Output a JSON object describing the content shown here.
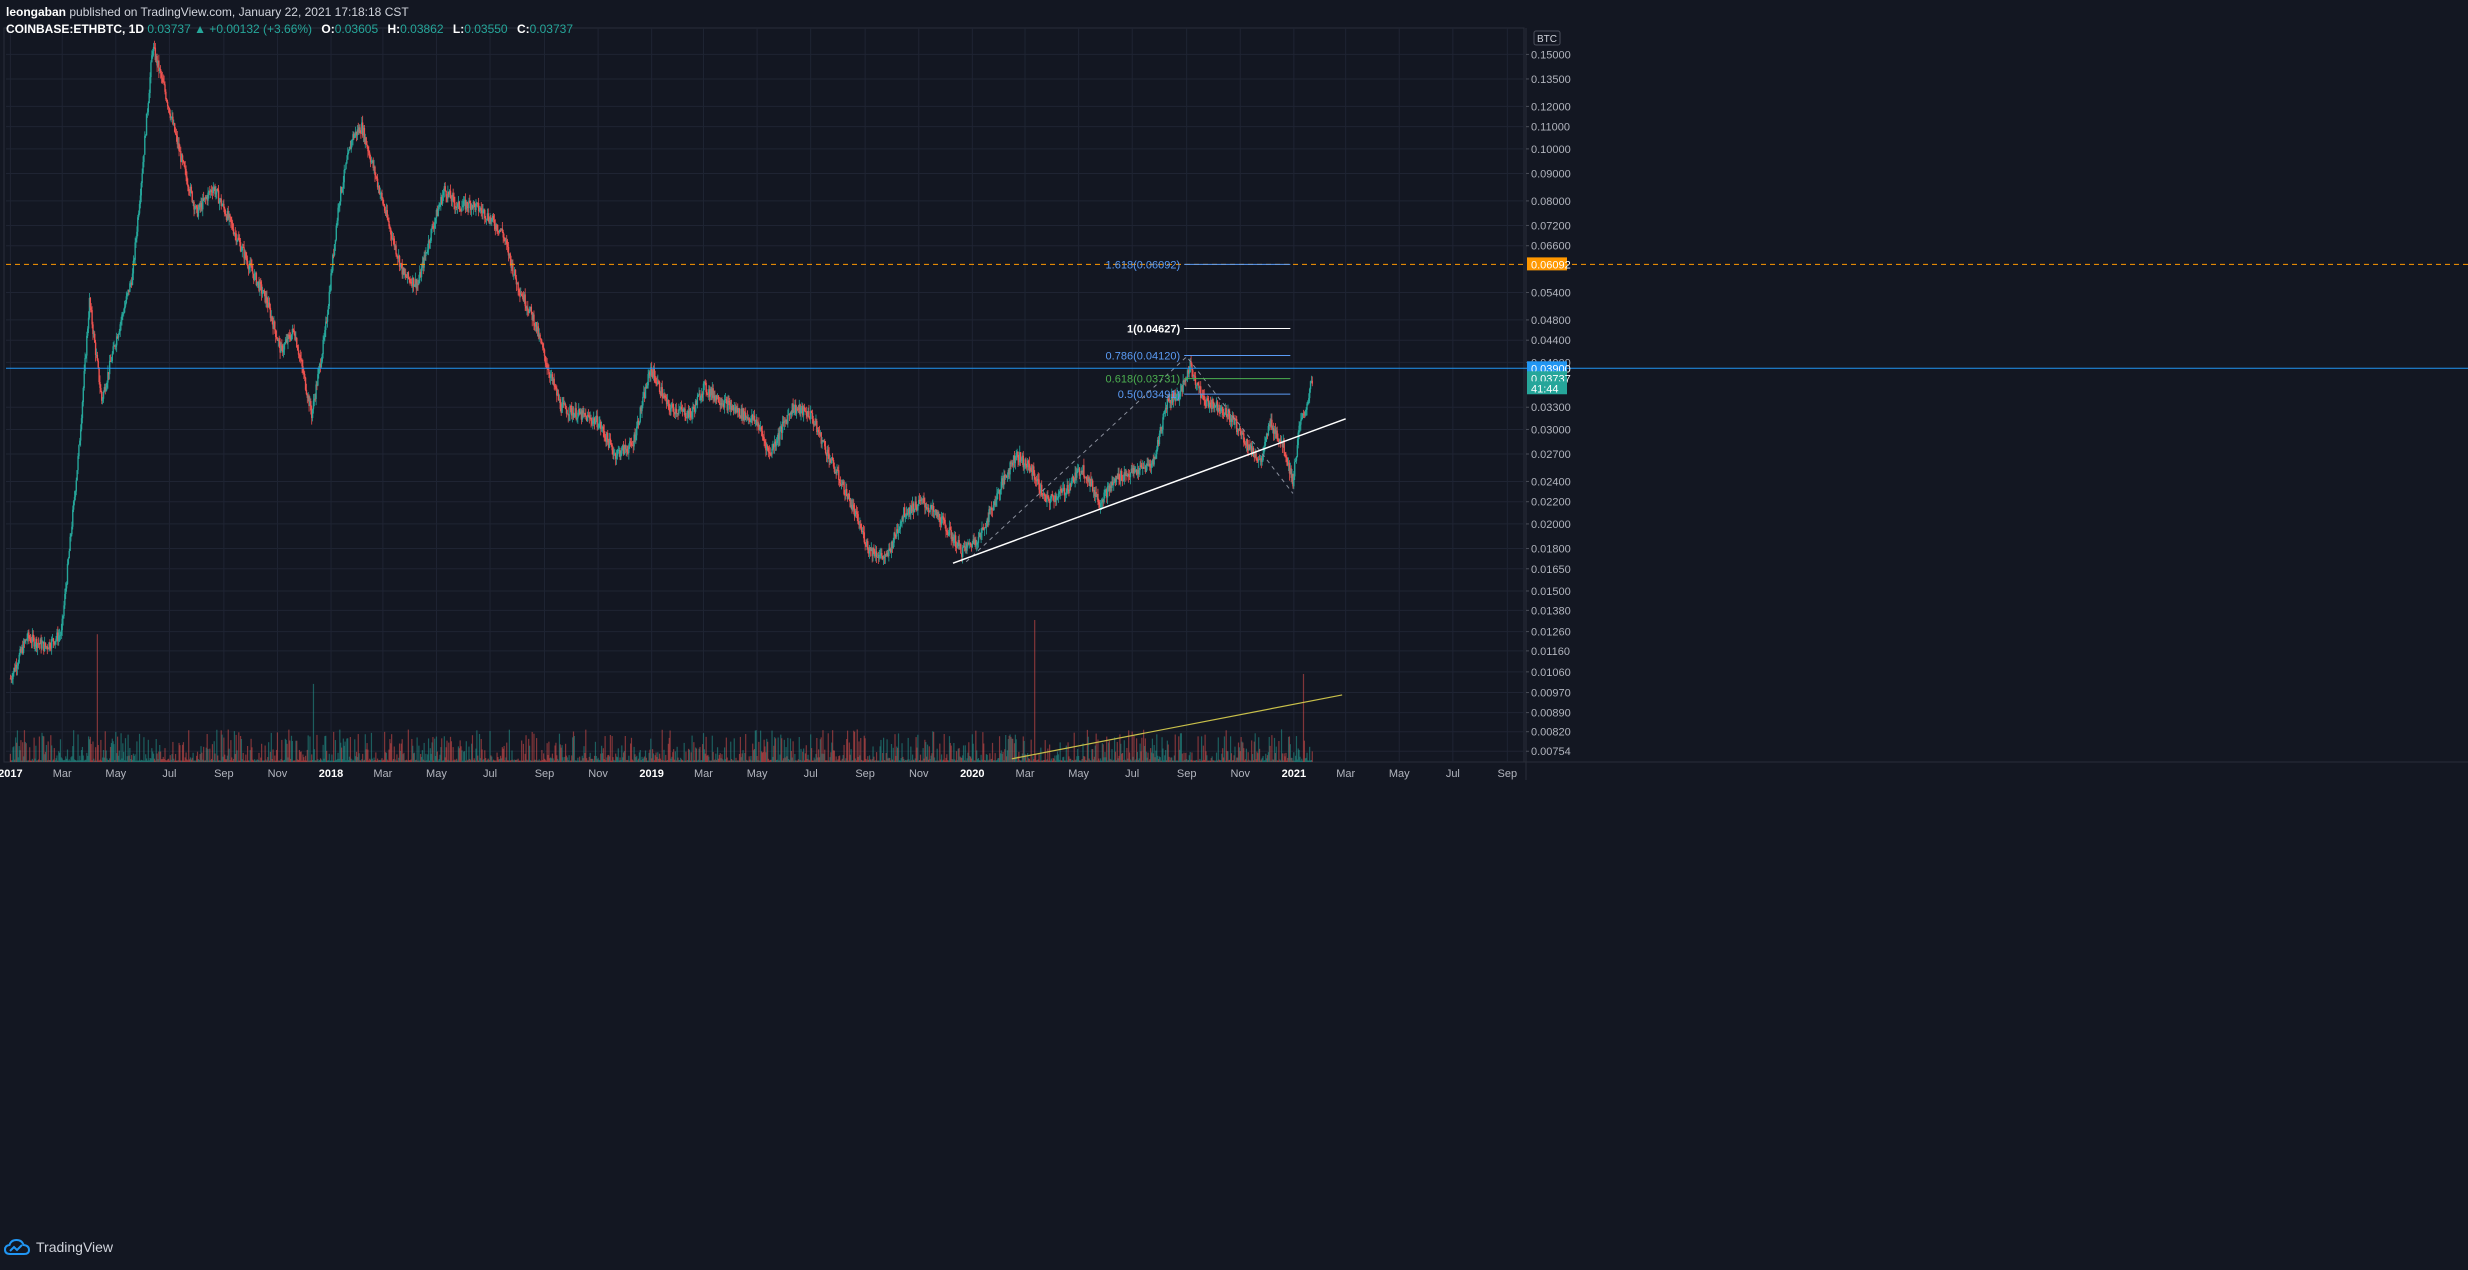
{
  "header": {
    "publisher": "leongaban",
    "published_text": "published on TradingView.com, January 22, 2021 17:18:18 CST",
    "symbol": "COINBASE:ETHBTC, 1D",
    "last": "0.03737",
    "change": "▲ +0.00132 (+3.66%)",
    "open_label": "O:",
    "open": "0.03605",
    "high_label": "H:",
    "high": "0.03862",
    "low_label": "L:",
    "low": "0.03550",
    "close_label": "C:",
    "close": "0.03737"
  },
  "footer": {
    "brand": "TradingView"
  },
  "colors": {
    "background": "#131722",
    "up": "#26a69a",
    "down": "#ef5350",
    "grid": "#1f2433",
    "blue_line": "#2196f3",
    "orange_line": "#ff9800",
    "trendline": "#ffffff",
    "volume_trend": "#c9c04a",
    "fib_blue": "#5b9cf6",
    "fib_green": "#4caf50"
  },
  "chart_data": {
    "type": "candlestick",
    "currency_label": "BTC",
    "y_scale": "log",
    "ylim": [
      0.0072,
      0.168
    ],
    "x_ticks": [
      "2017",
      "Mar",
      "May",
      "Jul",
      "Sep",
      "Nov",
      "2018",
      "Mar",
      "May",
      "Jul",
      "Sep",
      "Nov",
      "2019",
      "Mar",
      "May",
      "Jul",
      "Sep",
      "Nov",
      "2020",
      "Mar",
      "May",
      "Jul",
      "Sep",
      "Nov",
      "2021",
      "Mar",
      "May",
      "Jul",
      "Sep"
    ],
    "x_tick_dates": [
      "2017-01-01",
      "2017-03-01",
      "2017-05-01",
      "2017-07-01",
      "2017-09-01",
      "2017-11-01",
      "2018-01-01",
      "2018-03-01",
      "2018-05-01",
      "2018-07-01",
      "2018-09-01",
      "2018-11-01",
      "2019-01-01",
      "2019-03-01",
      "2019-05-01",
      "2019-07-01",
      "2019-09-01",
      "2019-11-01",
      "2020-01-01",
      "2020-03-01",
      "2020-05-01",
      "2020-07-01",
      "2020-09-01",
      "2020-11-01",
      "2021-01-01",
      "2021-03-01",
      "2021-05-01",
      "2021-07-01",
      "2021-09-01"
    ],
    "y_ticks": [
      "0.15000",
      "0.13500",
      "0.12000",
      "0.11000",
      "0.10000",
      "0.09000",
      "0.08000",
      "0.07200",
      "0.06600",
      "0.05400",
      "0.04800",
      "0.04400",
      "0.04000",
      "0.03300",
      "0.03000",
      "0.02700",
      "0.02400",
      "0.02200",
      "0.02000",
      "0.01800",
      "0.01650",
      "0.01500",
      "0.01380",
      "0.01260",
      "0.01160",
      "0.01060",
      "0.00970",
      "0.00890",
      "0.00820",
      "0.00754"
    ],
    "price_path": [
      [
        "2017-01-01",
        0.0103
      ],
      [
        "2017-01-20",
        0.0123
      ],
      [
        "2017-02-10",
        0.0118
      ],
      [
        "2017-02-28",
        0.0125
      ],
      [
        "2017-03-10",
        0.0185
      ],
      [
        "2017-03-20",
        0.0275
      ],
      [
        "2017-04-01",
        0.052
      ],
      [
        "2017-04-15",
        0.034
      ],
      [
        "2017-05-01",
        0.044
      ],
      [
        "2017-05-20",
        0.058
      ],
      [
        "2017-06-01",
        0.095
      ],
      [
        "2017-06-12",
        0.155
      ],
      [
        "2017-06-25",
        0.13
      ],
      [
        "2017-07-15",
        0.095
      ],
      [
        "2017-08-01",
        0.076
      ],
      [
        "2017-08-20",
        0.085
      ],
      [
        "2017-09-10",
        0.072
      ],
      [
        "2017-10-01",
        0.06
      ],
      [
        "2017-10-20",
        0.052
      ],
      [
        "2017-11-05",
        0.042
      ],
      [
        "2017-11-20",
        0.046
      ],
      [
        "2017-12-10",
        0.032
      ],
      [
        "2017-12-25",
        0.045
      ],
      [
        "2018-01-10",
        0.08
      ],
      [
        "2018-01-25",
        0.105
      ],
      [
        "2018-02-05",
        0.11
      ],
      [
        "2018-02-20",
        0.09
      ],
      [
        "2018-03-10",
        0.07
      ],
      [
        "2018-03-25",
        0.058
      ],
      [
        "2018-04-10",
        0.056
      ],
      [
        "2018-04-25",
        0.07
      ],
      [
        "2018-05-10",
        0.084
      ],
      [
        "2018-05-25",
        0.078
      ],
      [
        "2018-06-10",
        0.079
      ],
      [
        "2018-06-25",
        0.076
      ],
      [
        "2018-07-15",
        0.07
      ],
      [
        "2018-08-01",
        0.056
      ],
      [
        "2018-08-20",
        0.048
      ],
      [
        "2018-09-05",
        0.039
      ],
      [
        "2018-09-20",
        0.033
      ],
      [
        "2018-10-10",
        0.032
      ],
      [
        "2018-11-01",
        0.031
      ],
      [
        "2018-11-20",
        0.027
      ],
      [
        "2018-12-10",
        0.028
      ],
      [
        "2018-12-31",
        0.039
      ],
      [
        "2019-01-20",
        0.033
      ],
      [
        "2019-02-15",
        0.032
      ],
      [
        "2019-03-01",
        0.036
      ],
      [
        "2019-04-01",
        0.033
      ],
      [
        "2019-05-01",
        0.031
      ],
      [
        "2019-05-15",
        0.027
      ],
      [
        "2019-06-10",
        0.033
      ],
      [
        "2019-07-01",
        0.032
      ],
      [
        "2019-07-25",
        0.026
      ],
      [
        "2019-08-15",
        0.022
      ],
      [
        "2019-09-05",
        0.018
      ],
      [
        "2019-09-25",
        0.0172
      ],
      [
        "2019-10-15",
        0.021
      ],
      [
        "2019-11-05",
        0.022
      ],
      [
        "2019-11-25",
        0.0205
      ],
      [
        "2019-12-20",
        0.0178
      ],
      [
        "2020-01-10",
        0.019
      ],
      [
        "2020-02-05",
        0.024
      ],
      [
        "2020-02-20",
        0.027
      ],
      [
        "2020-03-10",
        0.025
      ],
      [
        "2020-03-25",
        0.022
      ],
      [
        "2020-04-15",
        0.023
      ],
      [
        "2020-05-05",
        0.0255
      ],
      [
        "2020-05-25",
        0.022
      ],
      [
        "2020-06-15",
        0.0245
      ],
      [
        "2020-07-05",
        0.025
      ],
      [
        "2020-07-25",
        0.026
      ],
      [
        "2020-08-10",
        0.034
      ],
      [
        "2020-08-25",
        0.035
      ],
      [
        "2020-09-05",
        0.0395
      ],
      [
        "2020-09-20",
        0.034
      ],
      [
        "2020-10-10",
        0.033
      ],
      [
        "2020-10-25",
        0.031
      ],
      [
        "2020-11-10",
        0.028
      ],
      [
        "2020-11-25",
        0.026
      ],
      [
        "2020-12-05",
        0.031
      ],
      [
        "2020-12-20",
        0.028
      ],
      [
        "2020-12-31",
        0.024
      ],
      [
        "2021-01-07",
        0.03
      ],
      [
        "2021-01-15",
        0.033
      ],
      [
        "2021-01-22",
        0.0374
      ]
    ],
    "horizontal_lines": [
      {
        "price": 0.039,
        "color": "#2196f3",
        "style": "solid",
        "label": "0.03900"
      },
      {
        "price": 0.06092,
        "color": "#ff9800",
        "style": "dashed",
        "label": "0.06092"
      }
    ],
    "price_labels": [
      {
        "price": 0.039,
        "text": "0.03900",
        "bg": "#2196f3"
      },
      {
        "price": 0.03737,
        "text": "0.03737",
        "bg": "#26a69a"
      },
      {
        "price": 0.0358,
        "text": "41:44",
        "bg": "#26a69a"
      },
      {
        "price": 0.06092,
        "text": "0.06092",
        "bg": "#ff9800"
      }
    ],
    "fib_levels": [
      {
        "label": "1.618(0.06092)",
        "price": 0.06092,
        "color": "#5b9cf6"
      },
      {
        "label": "1(0.04627)",
        "price": 0.04627,
        "color": "#ffffff"
      },
      {
        "label": "0.786(0.04120)",
        "price": 0.0412,
        "color": "#5b9cf6"
      },
      {
        "label": "0.618(0.03731)",
        "price": 0.03731,
        "color": "#4caf50"
      },
      {
        "label": "0.5(0.03491)",
        "price": 0.03491,
        "color": "#5b9cf6"
      }
    ],
    "trendline": {
      "from": [
        "2019-12-10",
        0.0169
      ],
      "to": [
        "2021-03-01",
        0.0314
      ]
    },
    "fib_swing": [
      [
        "2019-12-25",
        0.017
      ],
      [
        "2020-09-01",
        0.041
      ],
      [
        "2020-12-31",
        0.0228
      ]
    ],
    "volume_trendline": {
      "from": [
        "2020-02-15",
        0.0073
      ],
      "to": [
        "2021-02-25",
        0.0096
      ]
    },
    "volume_spikes": [
      {
        "date": "2017-04-10",
        "level": 0.9
      },
      {
        "date": "2017-12-12",
        "level": 0.55
      },
      {
        "date": "2020-03-12",
        "level": 1.0
      },
      {
        "date": "2021-01-12",
        "level": 0.62
      }
    ]
  }
}
